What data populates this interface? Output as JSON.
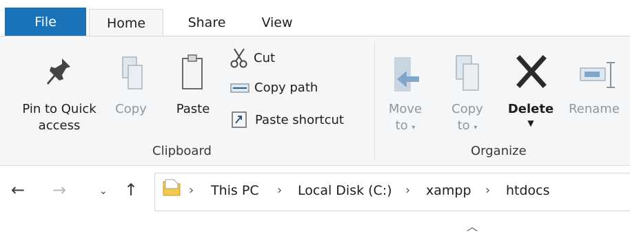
{
  "tabs": {
    "file": "File",
    "home": "Home",
    "share": "Share",
    "view": "View"
  },
  "ribbon": {
    "pin_line1": "Pin to Quick",
    "pin_line2": "access",
    "copy": "Copy",
    "paste": "Paste",
    "cut": "Cut",
    "copy_path": "Copy path",
    "paste_shortcut": "Paste shortcut",
    "clipboard_label": "Clipboard",
    "move_to_line1": "Move",
    "move_to_line2": "to",
    "copy_to_line1": "Copy",
    "copy_to_line2": "to",
    "delete": "Delete",
    "rename": "Rename",
    "organize_label": "Organize"
  },
  "address": {
    "crumbs": [
      "This PC",
      "Local Disk (C:)",
      "xampp",
      "htdocs"
    ]
  },
  "colors": {
    "file_tab": "#1a73b8",
    "ribbon_bg": "#f5f6f7",
    "delete_x": "#2b2b2b",
    "folder": "#f4c84a",
    "arrow_blue": "#7fa7c9"
  },
  "icons": {
    "back": "back-arrow-icon",
    "forward": "forward-arrow-icon",
    "recent": "chevron-down-icon",
    "up": "up-arrow-icon",
    "folder": "folder-icon",
    "collapse": "chevron-up-icon"
  }
}
